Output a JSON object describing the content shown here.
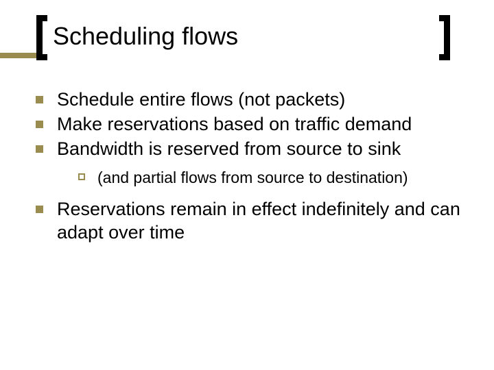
{
  "title": "Scheduling flows",
  "bullets": {
    "b0": "Schedule entire flows (not packets)",
    "b1": "Make reservations based on traffic demand",
    "b2": "Bandwidth is reserved from source to sink",
    "b2_sub": "(and partial flows from source to destination)",
    "b3": "Reservations remain in effect indefinitely and can adapt over time"
  }
}
